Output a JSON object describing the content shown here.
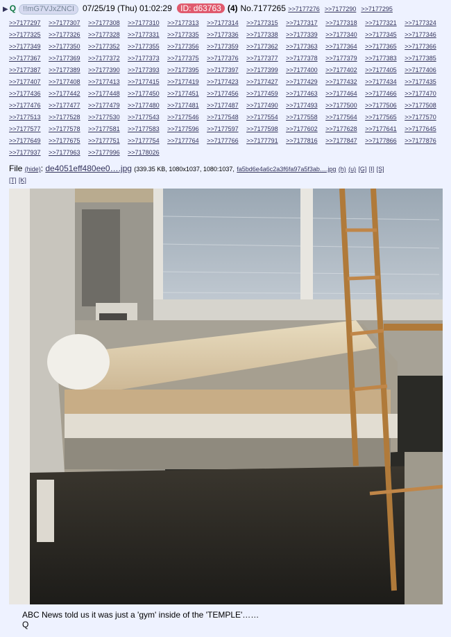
{
  "header": {
    "hide_icon": "triangle-right-icon",
    "name": "Q",
    "tripcode": "!!mG7VJxZNCI",
    "datetime": "07/25/19 (Thu) 01:02:29",
    "id_badge": "ID: d63763",
    "post_count": "(4)",
    "post_no": "No.7177265",
    "backlinks_inline": [
      ">>7177276",
      ">>7177290",
      ">>7177295"
    ]
  },
  "replies": [
    ">>7177297",
    ">>7177307",
    ">>7177308",
    ">>7177310",
    ">>7177313",
    ">>7177314",
    ">>7177315",
    ">>7177317",
    ">>7177318",
    ">>7177321",
    ">>7177324",
    ">>7177325",
    ">>7177326",
    ">>7177328",
    ">>7177331",
    ">>7177335",
    ">>7177336",
    ">>7177338",
    ">>7177339",
    ">>7177340",
    ">>7177345",
    ">>7177346",
    ">>7177349",
    ">>7177350",
    ">>7177352",
    ">>7177355",
    ">>7177356",
    ">>7177359",
    ">>7177362",
    ">>7177363",
    ">>7177364",
    ">>7177365",
    ">>7177366",
    ">>7177367",
    ">>7177369",
    ">>7177372",
    ">>7177373",
    ">>7177375",
    ">>7177376",
    ">>7177377",
    ">>7177378",
    ">>7177379",
    ">>7177383",
    ">>7177385",
    ">>7177387",
    ">>7177389",
    ">>7177390",
    ">>7177393",
    ">>7177395",
    ">>7177397",
    ">>7177399",
    ">>7177400",
    ">>7177402",
    ">>7177405",
    ">>7177406",
    ">>7177407",
    ">>7177408",
    ">>7177413",
    ">>7177415",
    ">>7177419",
    ">>7177423",
    ">>7177427",
    ">>7177429",
    ">>7177432",
    ">>7177434",
    ">>7177435",
    ">>7177436",
    ">>7177442",
    ">>7177448",
    ">>7177450",
    ">>7177451",
    ">>7177456",
    ">>7177459",
    ">>7177463",
    ">>7177464",
    ">>7177466",
    ">>7177470",
    ">>7177476",
    ">>7177477",
    ">>7177479",
    ">>7177480",
    ">>7177481",
    ">>7177487",
    ">>7177490",
    ">>7177493",
    ">>7177500",
    ">>7177506",
    ">>7177508",
    ">>7177513",
    ">>7177528",
    ">>7177530",
    ">>7177543",
    ">>7177546",
    ">>7177548",
    ">>7177554",
    ">>7177558",
    ">>7177564",
    ">>7177565",
    ">>7177570",
    ">>7177577",
    ">>7177578",
    ">>7177581",
    ">>7177583",
    ">>7177596",
    ">>7177597",
    ">>7177598",
    ">>7177602",
    ">>7177628",
    ">>7177641",
    ">>7177645",
    ">>7177649",
    ">>7177675",
    ">>7177751",
    ">>7177754",
    ">>7177764",
    ">>7177766",
    ">>7177791",
    ">>7177816",
    ">>7177847",
    ">>7177866",
    ">>7177876",
    ">>7177937",
    ">>7177963",
    ">>7177996",
    ">>7178026"
  ],
  "file": {
    "label": "File",
    "hide": "(hide)",
    "filename": "de4051eff480ee0….jpg",
    "meta": "(339.35 KB, 1080x1037, 1080:1037,",
    "orig_name": "fa5bd6e4a6c2a3f6fa97a5f3ab….jpg",
    "link_h": "(h)",
    "link_u": "(u)",
    "link_g": "[G]",
    "link_i": "[I]",
    "link_s": "[S]",
    "link_t": "[T]",
    "link_k": "[K]"
  },
  "message": {
    "line1": "ABC News told us it was just a 'gym' inside of the 'TEMPLE'……",
    "line2": "Q"
  }
}
